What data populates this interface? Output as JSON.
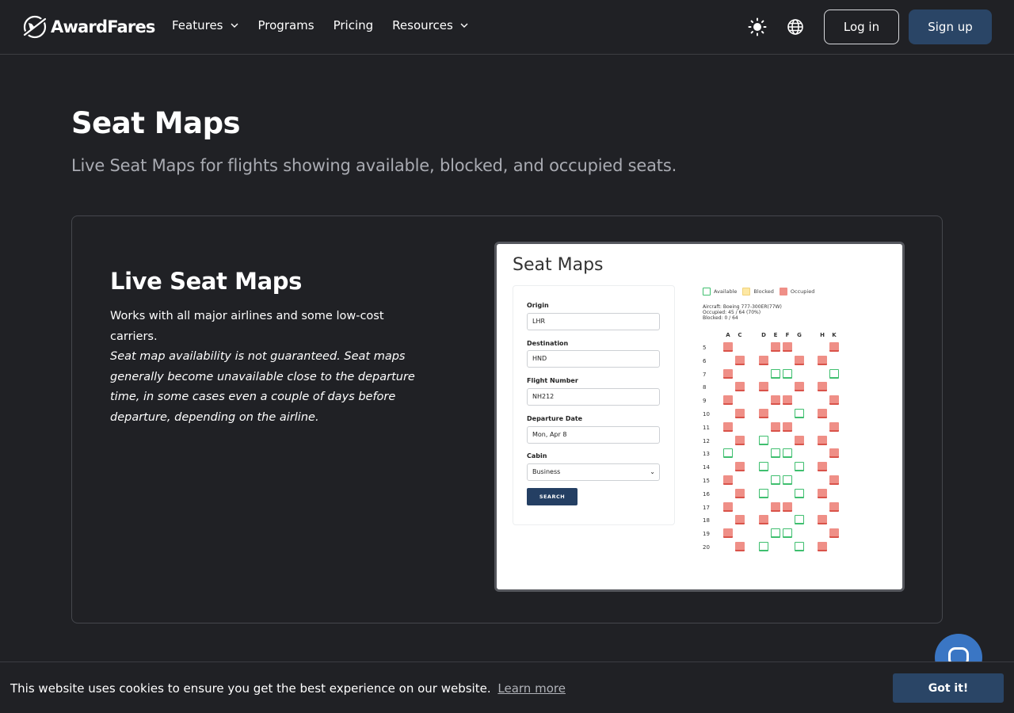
{
  "brand": {
    "name": "AwardFares"
  },
  "nav": {
    "links": [
      {
        "label": "Features",
        "has_dropdown": true
      },
      {
        "label": "Programs",
        "has_dropdown": false
      },
      {
        "label": "Pricing",
        "has_dropdown": false
      },
      {
        "label": "Resources",
        "has_dropdown": true
      }
    ],
    "theme_icon": "sun-icon",
    "language_icon": "globe-icon",
    "login_label": "Log in",
    "signup_label": "Sign up"
  },
  "hero": {
    "title": "Seat Maps",
    "subtitle": "Live Seat Maps for flights showing available, blocked, and occupied seats."
  },
  "feature": {
    "title": "Live Seat Maps",
    "line1": "Works with all major airlines and some low-cost carriers.",
    "note": "Seat map availability is not guaranteed. Seat maps generally become unavailable close to the departure time, in some cases even a couple of days before departure, depending on the airline."
  },
  "preview": {
    "title": "Seat Maps",
    "form": {
      "origin_label": "Origin",
      "origin_value": "LHR",
      "destination_label": "Destination",
      "destination_value": "HND",
      "flight_label": "Flight Number",
      "flight_value": "NH212",
      "date_label": "Departure Date",
      "date_value": "Mon, Apr 8",
      "cabin_label": "Cabin",
      "cabin_value": "Business",
      "search_label": "SEARCH"
    },
    "legend": {
      "available": "Available",
      "blocked": "Blocked",
      "occupied": "Occupied"
    },
    "meta": {
      "aircraft": "Aircraft: Boeing 777-300ER(77W)",
      "occupied": "Occupied: 45 / 64 (70%)",
      "blocked": "Blocked: 0 / 64"
    },
    "columns": [
      "A",
      "C",
      "D",
      "E",
      "F",
      "G",
      "H",
      "K"
    ],
    "rows": [
      {
        "n": "5",
        "A": "o",
        "E": "o",
        "F": "o",
        "K": "o"
      },
      {
        "n": "6",
        "C": "o",
        "D": "o",
        "G": "o",
        "H": "o"
      },
      {
        "n": "7",
        "A": "o",
        "E": "a",
        "F": "a",
        "K": "a"
      },
      {
        "n": "8",
        "C": "o",
        "D": "o",
        "G": "o",
        "H": "o"
      },
      {
        "n": "9",
        "A": "o",
        "E": "o",
        "F": "o",
        "K": "o"
      },
      {
        "n": "10",
        "C": "o",
        "D": "o",
        "G": "a",
        "H": "o"
      },
      {
        "n": "11",
        "A": "o",
        "E": "o",
        "F": "o",
        "K": "o"
      },
      {
        "n": "12",
        "C": "o",
        "D": "a",
        "G": "o",
        "H": "o"
      },
      {
        "n": "13",
        "A": "a",
        "E": "a",
        "F": "a",
        "K": "o"
      },
      {
        "n": "14",
        "C": "o",
        "D": "a",
        "G": "a",
        "H": "o"
      },
      {
        "n": "15",
        "A": "o",
        "E": "a",
        "F": "a",
        "K": "o"
      },
      {
        "n": "16",
        "C": "o",
        "D": "a",
        "G": "a",
        "H": "o"
      },
      {
        "n": "17",
        "A": "o",
        "E": "o",
        "F": "o",
        "K": "o"
      },
      {
        "n": "18",
        "C": "o",
        "D": "o",
        "G": "a",
        "H": "o"
      },
      {
        "n": "19",
        "A": "o",
        "E": "a",
        "F": "a",
        "K": "o"
      },
      {
        "n": "20",
        "C": "o",
        "D": "a",
        "G": "a",
        "H": "o"
      }
    ],
    "colors": {
      "occupied": "#ef8f87",
      "available": "#3fbf6f",
      "blocked": "#fde8a4"
    }
  },
  "cookie": {
    "text": "This website uses cookies to ensure you get the best experience on our website.",
    "link": "Learn more",
    "button": "Got it!"
  },
  "chat_icon": "chat-bubble-icon",
  "colors": {
    "background": "#202125",
    "accent": "#2a4566"
  }
}
